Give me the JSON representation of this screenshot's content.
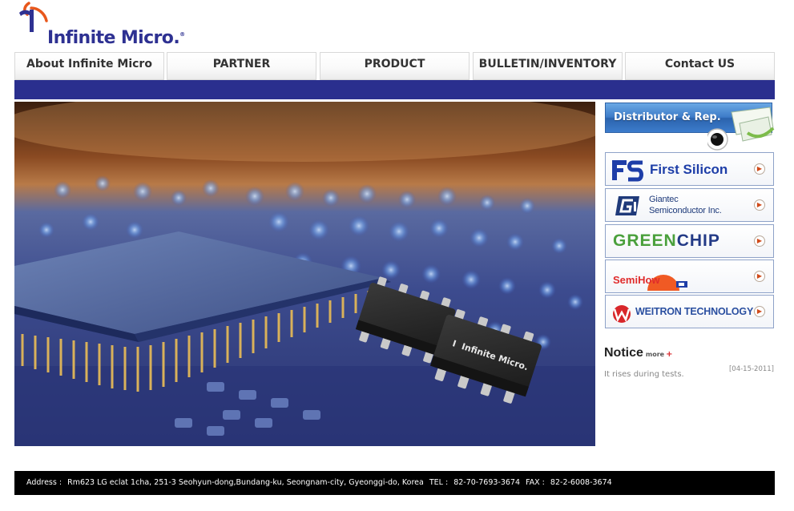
{
  "brand": {
    "name": "Infinite Micro",
    "name_suffix": ".",
    "registered": "®",
    "color_primary": "#2e3192",
    "color_accent": "#e8571b"
  },
  "nav": {
    "tabs": [
      {
        "label": "About Infinite Micro"
      },
      {
        "label": "PARTNER"
      },
      {
        "label": "PRODUCT"
      },
      {
        "label": "BULLETIN/INVENTORY"
      },
      {
        "label": "Contact US"
      }
    ],
    "bar_color": "#2a2f8e"
  },
  "hero": {
    "chip_marking": "Infinite Micro.",
    "chip_logo": "I"
  },
  "sidebar": {
    "distributor_label": "Distributor & Rep.",
    "partners": [
      {
        "name": "First Silicon",
        "icon": "first-silicon-logo"
      },
      {
        "name_line1": "Giantec",
        "name_line2": "Semiconductor Inc.",
        "icon": "giantec-logo"
      },
      {
        "name_part1": "GREEN",
        "name_part2": "CHIP",
        "color1": "#4aa03c",
        "color2": "#233a86"
      },
      {
        "name_part1": "SemiHo",
        "name_part2": "w",
        "icon": "semihow-logo"
      },
      {
        "name": "WEITRON TECHNOLOGY",
        "icon": "weitron-logo"
      }
    ]
  },
  "notice": {
    "title": "Notice",
    "more_label": "more",
    "more_icon": "+",
    "items": [
      {
        "text": "It rises during tests.",
        "date": "[04-15-2011]"
      }
    ]
  },
  "footer": {
    "address_label": "Address :",
    "address": "Rm623 LG eclat 1cha, 251-3 Seohyun-dong,Bundang-ku, Seongnam-city, Gyeonggi-do, Korea",
    "tel_label": "TEL :",
    "tel": "82-70-7693-3674",
    "fax_label": "FAX :",
    "fax": "82-2-6008-3674"
  }
}
